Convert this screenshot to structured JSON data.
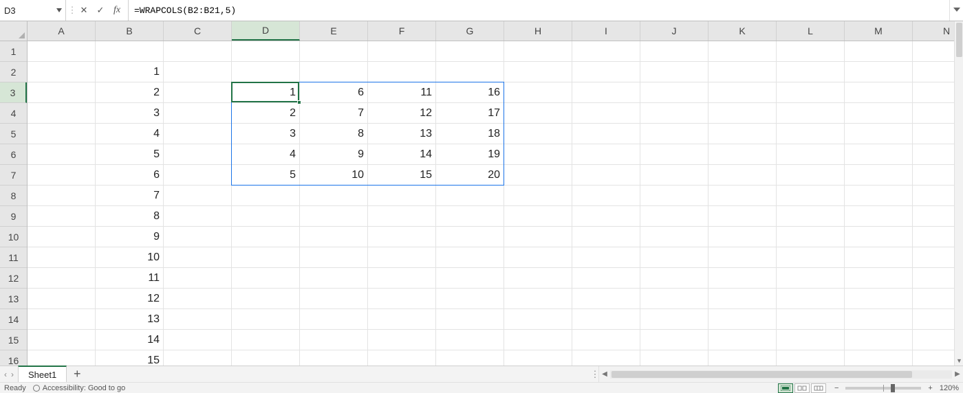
{
  "name_box": "D3",
  "formula": "=WRAPCOLS(B2:B21,5)",
  "columns": [
    "A",
    "B",
    "C",
    "D",
    "E",
    "F",
    "G",
    "H",
    "I",
    "J",
    "K",
    "L",
    "M",
    "N"
  ],
  "rows_visible": [
    1,
    2,
    3,
    4,
    5,
    6,
    7,
    8,
    9,
    10,
    11,
    12,
    13,
    14,
    15,
    16
  ],
  "active_cell": {
    "col": "D",
    "row": 3,
    "col_index": 3,
    "row_index": 2
  },
  "spill_range": {
    "start_col_index": 3,
    "start_row_index": 2,
    "width_cols": 4,
    "height_rows": 5
  },
  "column_B": {
    "2": "1",
    "3": "2",
    "4": "3",
    "5": "4",
    "6": "5",
    "7": "6",
    "8": "7",
    "9": "8",
    "10": "9",
    "11": "10",
    "12": "11",
    "13": "12",
    "14": "13",
    "15": "14",
    "16": "15"
  },
  "wrap_output": {
    "D": {
      "3": "1",
      "4": "2",
      "5": "3",
      "6": "4",
      "7": "5"
    },
    "E": {
      "3": "6",
      "4": "7",
      "5": "8",
      "6": "9",
      "7": "10"
    },
    "F": {
      "3": "11",
      "4": "12",
      "5": "13",
      "6": "14",
      "7": "15"
    },
    "G": {
      "3": "16",
      "4": "17",
      "5": "18",
      "6": "19",
      "7": "20"
    }
  },
  "sheet_tabs": [
    "Sheet1"
  ],
  "status": {
    "ready": "Ready",
    "accessibility": "Accessibility: Good to go",
    "zoom_label": "120%"
  },
  "buttons": {
    "cancel": "✕",
    "enter": "✓",
    "fx": "fx"
  },
  "colors": {
    "accent": "#217346",
    "spill_border": "#1a73e8"
  }
}
